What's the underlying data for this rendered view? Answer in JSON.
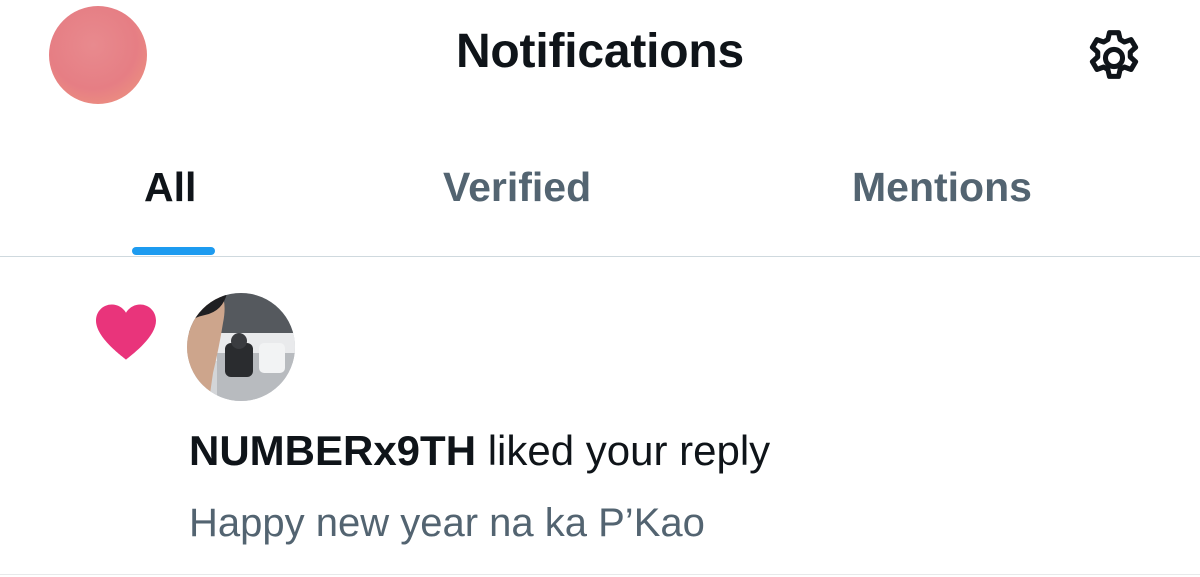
{
  "header": {
    "title": "Notifications",
    "avatar_icon": "user-avatar",
    "settings_icon": "gear-icon"
  },
  "tabs": [
    {
      "label": "All",
      "active": true
    },
    {
      "label": "Verified",
      "active": false
    },
    {
      "label": "Mentions",
      "active": false
    }
  ],
  "notifications": [
    {
      "type_icon": "heart-icon",
      "actor": "NUMBERx9TH",
      "action": " liked your reply",
      "snippet": "Happy new year na ka P’Kao"
    }
  ],
  "colors": {
    "accent": "#1d9bf0",
    "heart": "#e9347b",
    "text_primary": "#0f1419",
    "text_secondary": "#536471"
  }
}
